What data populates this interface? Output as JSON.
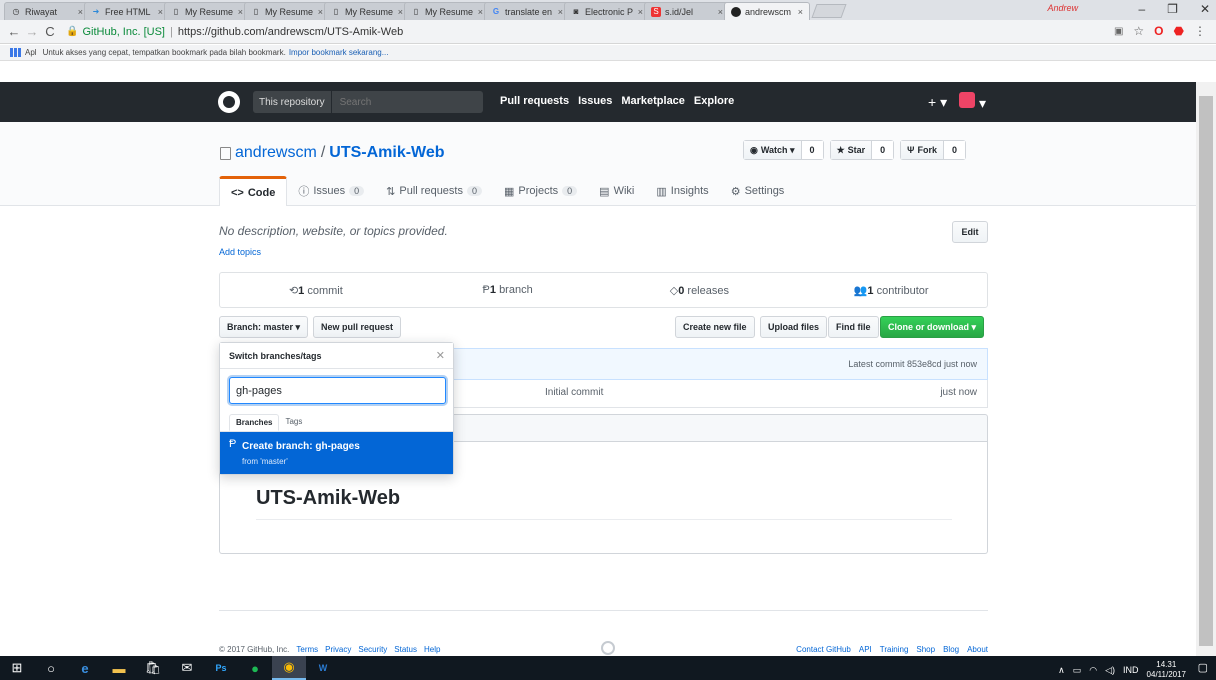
{
  "browser": {
    "tabs": [
      {
        "label": "Riwayat",
        "icon": "history-icon"
      },
      {
        "label": "Free HTML",
        "icon": "html-icon"
      },
      {
        "label": "My Resume",
        "icon": "page-icon"
      },
      {
        "label": "My Resume",
        "icon": "page-icon"
      },
      {
        "label": "My Resume",
        "icon": "page-icon"
      },
      {
        "label": "My Resume",
        "icon": "page-icon"
      },
      {
        "label": "translate en",
        "icon": "google-icon"
      },
      {
        "label": "Electronic P",
        "icon": "camera-icon"
      },
      {
        "label": "s.id/Jel",
        "icon": "s-icon"
      },
      {
        "label": "andrewscm",
        "icon": "github-icon"
      }
    ],
    "profile_name": "Andrew",
    "address": {
      "org": "GitHub, Inc. [US]",
      "url": "https://github.com/andrewscm/UTS-Amik-Web"
    },
    "bookmarks_bar": {
      "apps_label": "Apl",
      "message": "Untuk akses yang cepat, tempatkan bookmark pada bilah bookmark.",
      "import_link": "Impor bookmark sekarang..."
    }
  },
  "github": {
    "header": {
      "scope_label": "This repository",
      "search_placeholder": "Search",
      "nav": [
        "Pull requests",
        "Issues",
        "Marketplace",
        "Explore"
      ],
      "plus": "+ ▾"
    },
    "repo": {
      "owner": "andrewscm",
      "name": "UTS-Amik-Web",
      "watch": {
        "label": "Watch ▾",
        "count": "0"
      },
      "star": {
        "label": "Star",
        "count": "0"
      },
      "fork": {
        "label": "Fork",
        "count": "0"
      },
      "tabs": [
        {
          "label": "Code",
          "icon": "<>",
          "counter": ""
        },
        {
          "label": "Issues",
          "icon": "ⓘ",
          "counter": "0"
        },
        {
          "label": "Pull requests",
          "icon": "⇅",
          "counter": "0"
        },
        {
          "label": "Projects",
          "icon": "▦",
          "counter": "0"
        },
        {
          "label": "Wiki",
          "icon": "▤",
          "counter": ""
        },
        {
          "label": "Insights",
          "icon": "▥",
          "counter": ""
        },
        {
          "label": "Settings",
          "icon": "⚙",
          "counter": ""
        }
      ],
      "description": "No description, website, or topics provided.",
      "add_topics": "Add topics",
      "edit": "Edit",
      "summary": {
        "commits": {
          "num": "1",
          "label": "commit"
        },
        "branches": {
          "num": "1",
          "label": "branch"
        },
        "releases": {
          "num": "0",
          "label": "releases"
        },
        "contributors": {
          "num": "1",
          "label": "contributor"
        }
      },
      "branch_button": "Branch: master ▾",
      "new_pr": "New pull request",
      "create_file": "Create new file",
      "upload_files": "Upload files",
      "find_file": "Find file",
      "clone": "Clone or download ▾",
      "latest_commit": "Latest commit 853e8cd just now",
      "file_row": {
        "message": "Initial commit",
        "age": "just now"
      },
      "readme_title": "UTS-Amik-Web"
    },
    "branch_dropdown": {
      "title": "Switch branches/tags",
      "filter_value": "gh-pages",
      "tabs": [
        "Branches",
        "Tags"
      ],
      "create_label": "Create branch: gh-pages",
      "create_sub": "from 'master'"
    },
    "footer": {
      "copyright": "© 2017 GitHub, Inc.",
      "left_links": [
        "Terms",
        "Privacy",
        "Security",
        "Status",
        "Help"
      ],
      "right_links": [
        "Contact GitHub",
        "API",
        "Training",
        "Shop",
        "Blog",
        "About"
      ]
    }
  },
  "taskbar": {
    "language": "IND",
    "time": "14.31",
    "date": "04/11/2017"
  }
}
